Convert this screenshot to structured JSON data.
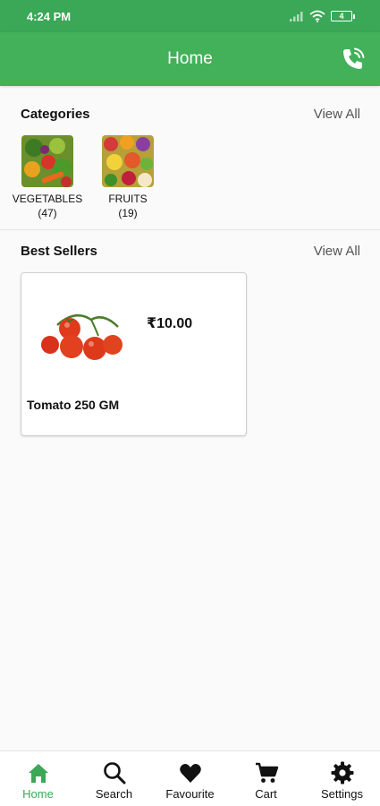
{
  "status": {
    "time": "4:24 PM",
    "battery": "4"
  },
  "appbar": {
    "title": "Home",
    "call_icon": "phone-call-icon"
  },
  "categories": {
    "title": "Categories",
    "view_all": "View All",
    "items": [
      {
        "name": "VEGETABLES",
        "count": "(47)"
      },
      {
        "name": "FRUITS",
        "count": "(19)"
      }
    ]
  },
  "best_sellers": {
    "title": "Best Sellers",
    "view_all": "View All",
    "products": [
      {
        "name": "Tomato 250 GM",
        "price": "₹10.00"
      }
    ]
  },
  "nav": {
    "items": [
      {
        "label": "Home",
        "icon": "home-icon",
        "active": true
      },
      {
        "label": "Search",
        "icon": "search-icon",
        "active": false
      },
      {
        "label": "Favourite",
        "icon": "heart-icon",
        "active": false
      },
      {
        "label": "Cart",
        "icon": "cart-icon",
        "active": false
      },
      {
        "label": "Settings",
        "icon": "gear-icon",
        "active": false
      }
    ]
  },
  "colors": {
    "primary": "#43b05a",
    "statusbar": "#3aa857",
    "active_nav": "#3aa857"
  }
}
